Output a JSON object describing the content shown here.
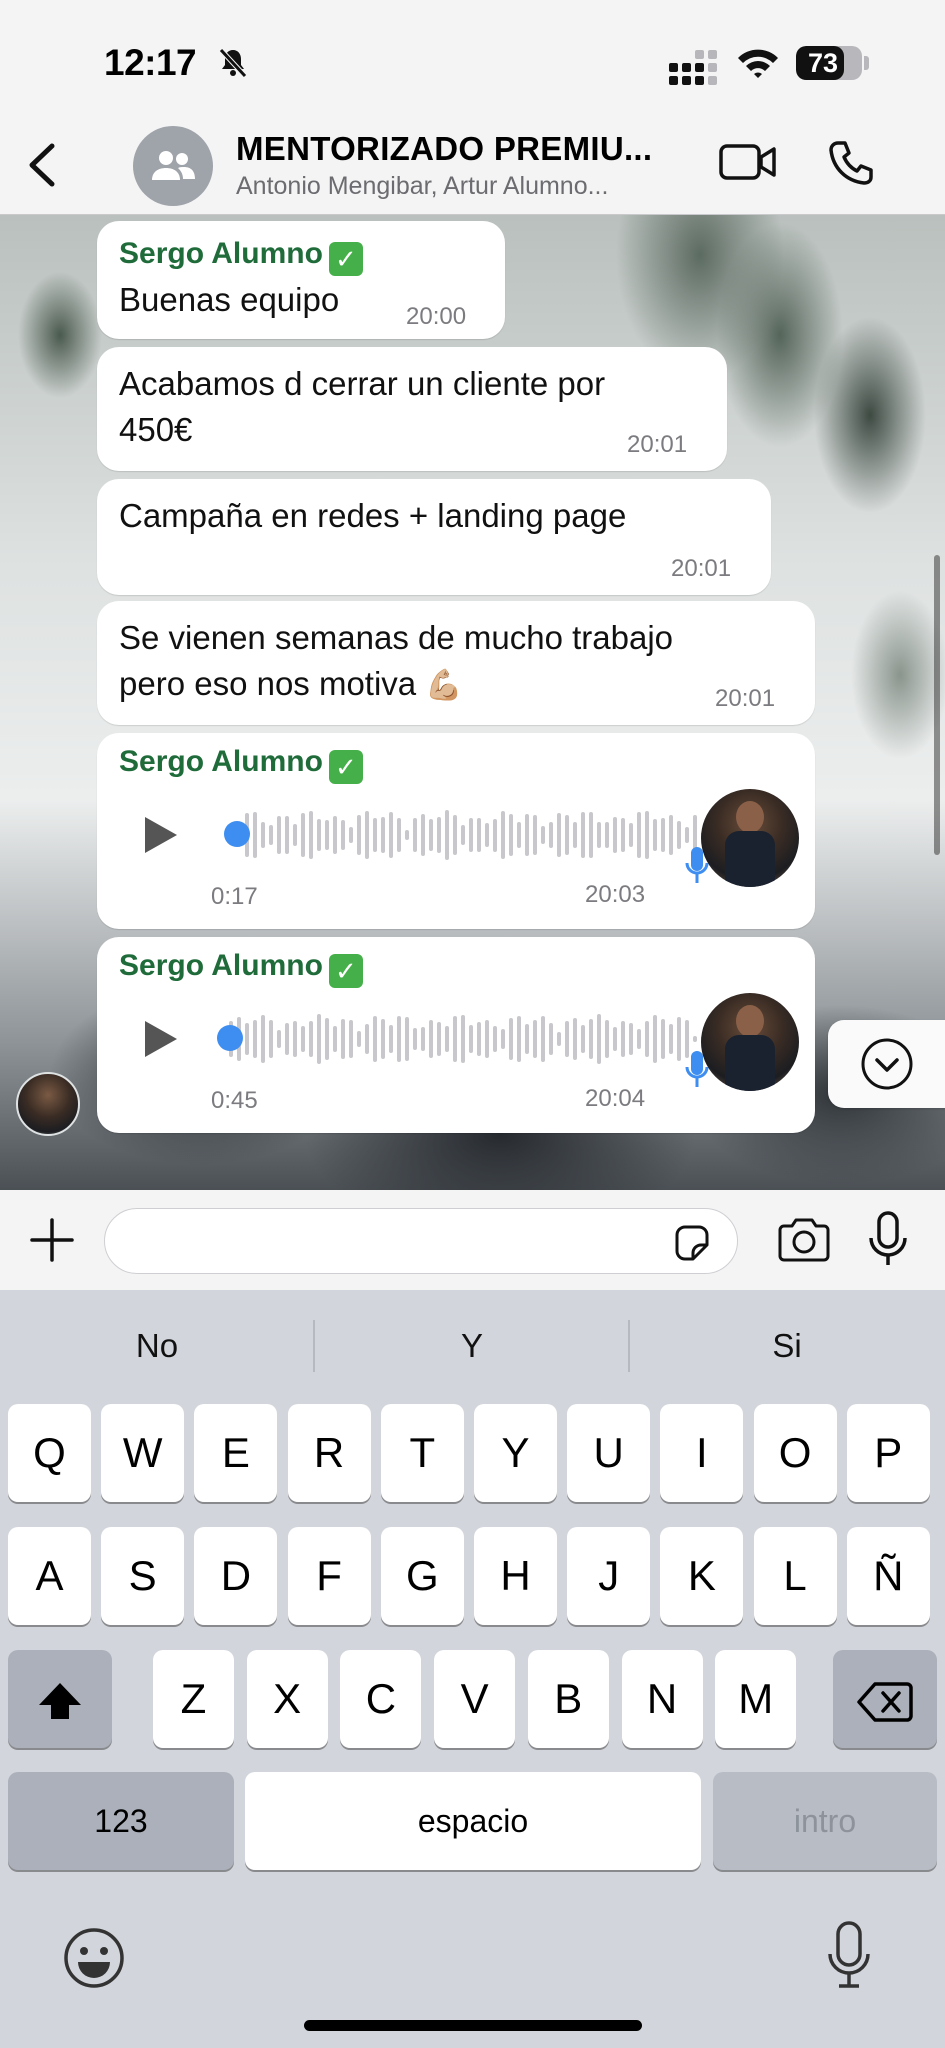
{
  "status_bar": {
    "time": "12:17",
    "battery": "73",
    "battery_level": 0.73
  },
  "header": {
    "title": "MENTORIZADO PREMIU...",
    "subtitle": "Antonio Mengibar, Artur Alumno..."
  },
  "messages": [
    {
      "sender": "Sergo Alumno",
      "text": "Buenas equipo",
      "time": "20:00"
    },
    {
      "text_lines": [
        "Acabamos d cerrar un cliente por",
        "450€"
      ],
      "time": "20:01"
    },
    {
      "text": "Campaña en redes + landing page",
      "time": "20:01"
    },
    {
      "text_lines": [
        "Se vienen semanas de mucho trabajo",
        "pero eso nos motiva"
      ],
      "emoji": "💪🏼",
      "time": "20:01"
    },
    {
      "sender": "Sergo Alumno",
      "type": "voice",
      "duration": "0:17",
      "time": "20:03"
    },
    {
      "sender": "Sergo Alumno",
      "type": "voice",
      "duration": "0:45",
      "time": "20:04"
    }
  ],
  "input": {
    "placeholder": ""
  },
  "keyboard": {
    "suggestions": [
      "No",
      "Y",
      "Si"
    ],
    "row1": [
      "Q",
      "W",
      "E",
      "R",
      "T",
      "Y",
      "U",
      "I",
      "O",
      "P"
    ],
    "row2": [
      "A",
      "S",
      "D",
      "F",
      "G",
      "H",
      "J",
      "K",
      "L",
      "Ñ"
    ],
    "row3": [
      "Z",
      "X",
      "C",
      "V",
      "B",
      "N",
      "M"
    ],
    "numbers_label": "123",
    "space_label": "espacio",
    "return_label": "intro"
  },
  "colors": {
    "sender": "#1f6b3a",
    "voice_accent": "#3d8ef0",
    "verified": "#45b04a"
  }
}
